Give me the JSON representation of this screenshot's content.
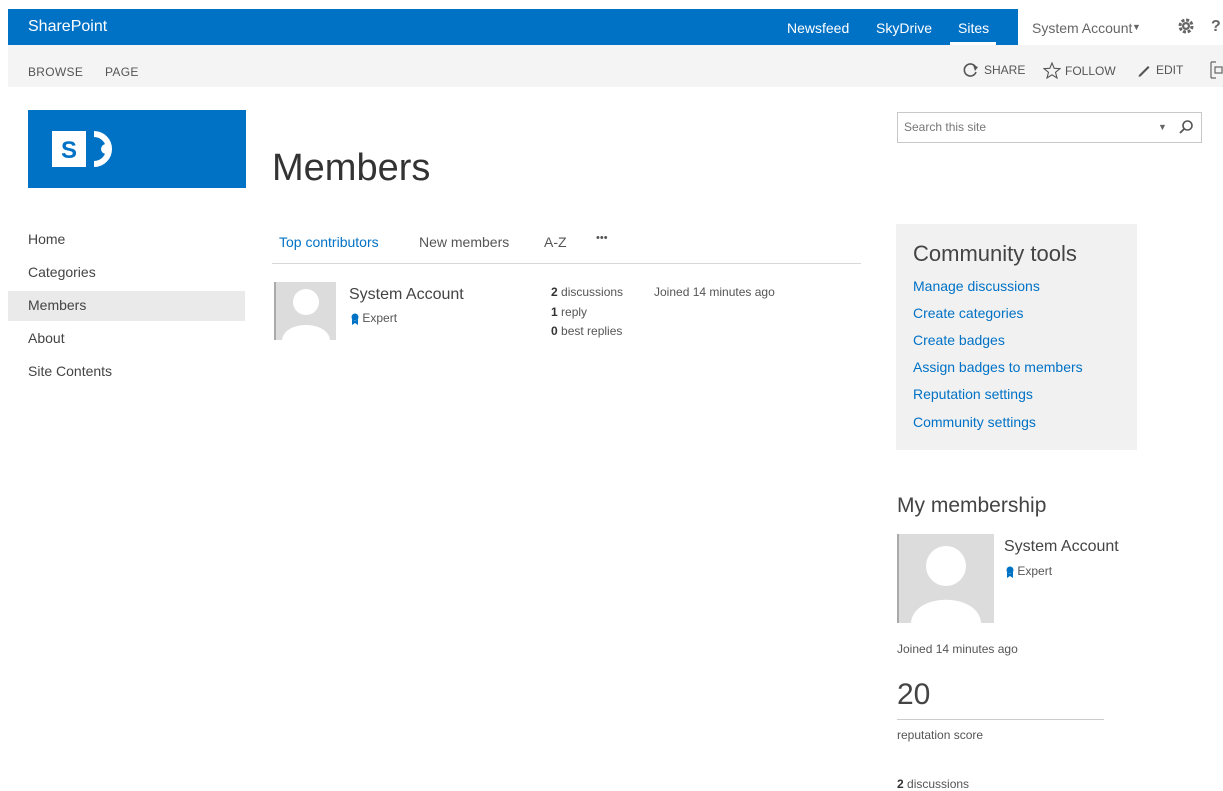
{
  "suite": {
    "brand": "SharePoint",
    "links": [
      "Newsfeed",
      "SkyDrive",
      "Sites"
    ],
    "user": "System Account",
    "help": "?"
  },
  "ribbon": {
    "tabs": [
      "BROWSE",
      "PAGE"
    ],
    "actions": {
      "share": "SHARE",
      "follow": "FOLLOW",
      "edit": "EDIT"
    }
  },
  "page": {
    "title": "Members"
  },
  "search": {
    "placeholder": "Search this site"
  },
  "nav": {
    "items": [
      "Home",
      "Categories",
      "Members",
      "About",
      "Site Contents"
    ],
    "selected": "Members"
  },
  "member_tabs": {
    "items": [
      "Top contributors",
      "New members",
      "A-Z"
    ],
    "more": "•••",
    "active": "Top contributors"
  },
  "members": [
    {
      "name": "System Account",
      "badge": "Expert",
      "discussions_count": "2",
      "discussions_label": "discussions",
      "replies_count": "1",
      "replies_label": "reply",
      "best_count": "0",
      "best_label": "best replies",
      "joined": "Joined 14 minutes ago"
    }
  ],
  "community_tools": {
    "title": "Community tools",
    "links": [
      "Manage discussions",
      "Create categories",
      "Create badges",
      "Assign badges to members",
      "Reputation settings",
      "Community settings"
    ]
  },
  "membership": {
    "title": "My membership",
    "name": "System Account",
    "badge": "Expert",
    "joined": "Joined 14 minutes ago",
    "score": "20",
    "score_label": "reputation score",
    "discussions_count": "2",
    "discussions_label": "discussions"
  },
  "colors": {
    "accent": "#0072c6",
    "tools_bg": "#f1f1f1"
  }
}
